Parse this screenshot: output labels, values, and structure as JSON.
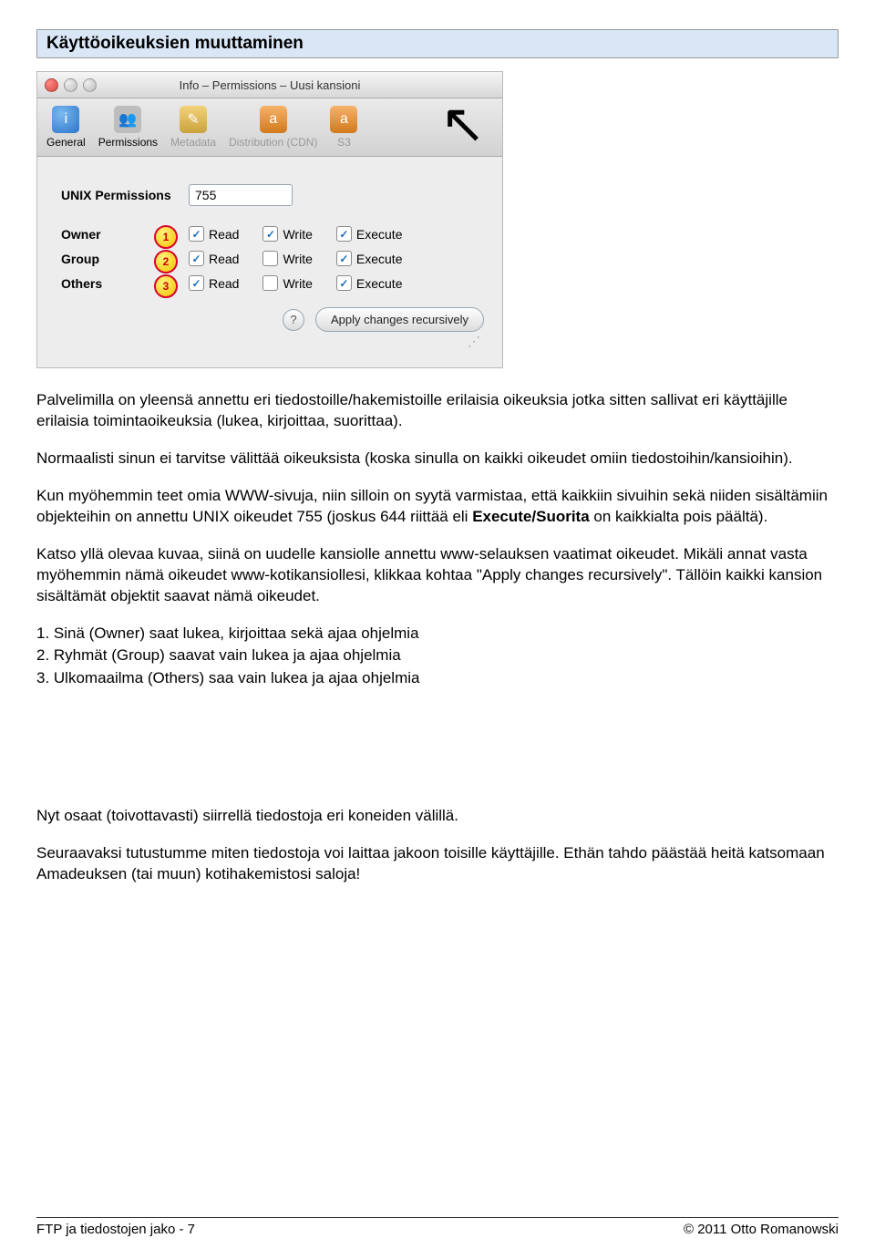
{
  "section_title": "Käyttöoikeuksien muuttaminen",
  "window": {
    "title": "Info – Permissions – Uusi kansioni",
    "tabs": {
      "general": "General",
      "permissions": "Permissions",
      "metadata": "Metadata",
      "distribution": "Distribution (CDN)",
      "s3": "S3"
    },
    "unix_label": "UNIX Permissions",
    "unix_value": "755",
    "rows": [
      {
        "label": "Owner",
        "read": "Read",
        "write": "Write",
        "execute": "Execute",
        "read_on": true,
        "write_on": true,
        "exec_on": true,
        "marker": "1"
      },
      {
        "label": "Group",
        "read": "Read",
        "write": "Write",
        "execute": "Execute",
        "read_on": true,
        "write_on": false,
        "exec_on": true,
        "marker": "2"
      },
      {
        "label": "Others",
        "read": "Read",
        "write": "Write",
        "execute": "Execute",
        "read_on": true,
        "write_on": false,
        "exec_on": true,
        "marker": "3"
      }
    ],
    "help": "?",
    "apply": "Apply changes recursively"
  },
  "para": {
    "p1": "Palvelimilla on yleensä annettu eri tiedostoille/hakemistoille erilaisia oikeuksia jotka sitten sallivat eri käyttäjille erilaisia toimintaoikeuksia (lukea, kirjoittaa, suorittaa).",
    "p2": "Normaalisti sinun ei tarvitse välittää oikeuksista (koska sinulla on kaikki oikeudet omiin tiedostoihin/kansioihin).",
    "p3a": "Kun myöhemmin teet omia WWW-sivuja, niin silloin on syytä varmistaa, että kaikkiin sivuihin sekä niiden sisältämiin objekteihin on annettu UNIX oikeudet 755 (joskus 644 riittää eli ",
    "p3b": "Execute/Suorita",
    "p3c": " on kaikkialta pois päältä).",
    "p4": "Katso yllä olevaa kuvaa, siinä on uudelle kansiolle annettu www-selauksen vaatimat oikeudet. Mikäli annat vasta myöhemmin nämä oikeudet www-kotikansiollesi, klikkaa kohtaa \"Apply changes recursively\". Tällöin kaikki kansion sisältämät objektit saavat nämä oikeudet.",
    "l1": "1. Sinä (Owner) saat lukea, kirjoittaa sekä ajaa ohjelmia",
    "l2": "2. Ryhmät (Group) saavat vain lukea ja ajaa ohjelmia",
    "l3": "3. Ulkomaailma (Others) saa vain lukea ja ajaa ohjelmia",
    "p5": "Nyt osaat (toivottavasti) siirrellä tiedostoja eri koneiden välillä.",
    "p6": "Seuraavaksi tutustumme miten tiedostoja voi laittaa jakoon toisille käyttäjille. Ethän tahdo päästää heitä katsomaan Amadeuksen (tai muun) kotihakemistosi saloja!"
  },
  "footer": {
    "left": "FTP ja tiedostojen jako - 7",
    "right": "© 2011 Otto Romanowski"
  }
}
